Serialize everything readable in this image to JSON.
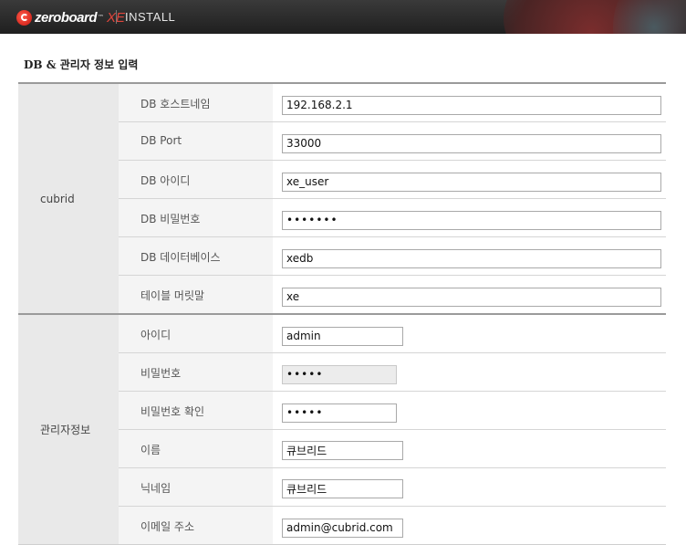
{
  "header": {
    "logo_word": "zeroboard",
    "logo_tm": "™",
    "logo_xe": "XE",
    "install_label": "INSTALL"
  },
  "section_title": "DB & 관리자 정보 입력",
  "db_group": {
    "label": "cubrid",
    "rows": [
      {
        "label": "DB 호스트네임",
        "value": "192.168.2.1",
        "type": "text"
      },
      {
        "label": "DB Port",
        "value": "33000",
        "type": "text"
      },
      {
        "label": "DB 아이디",
        "value": "xe_user",
        "type": "text"
      },
      {
        "label": "DB 비밀번호",
        "value": "xeuser1",
        "type": "password"
      },
      {
        "label": "DB 데이터베이스",
        "value": "xedb",
        "type": "text"
      },
      {
        "label": "테이블 머릿말",
        "value": "xe",
        "type": "text"
      }
    ]
  },
  "admin_group": {
    "label": "관리자정보",
    "rows": [
      {
        "label": "아이디",
        "value": "admin",
        "type": "text"
      },
      {
        "label": "비밀번호",
        "value": "admin",
        "type": "password"
      },
      {
        "label": "비밀번호 확인",
        "value": "admin",
        "type": "password"
      },
      {
        "label": "이름",
        "value": "큐브리드",
        "type": "text"
      },
      {
        "label": "닉네임",
        "value": "큐브리드",
        "type": "text"
      },
      {
        "label": "이메일 주소",
        "value": "admin@cubrid.com",
        "type": "text"
      }
    ]
  }
}
